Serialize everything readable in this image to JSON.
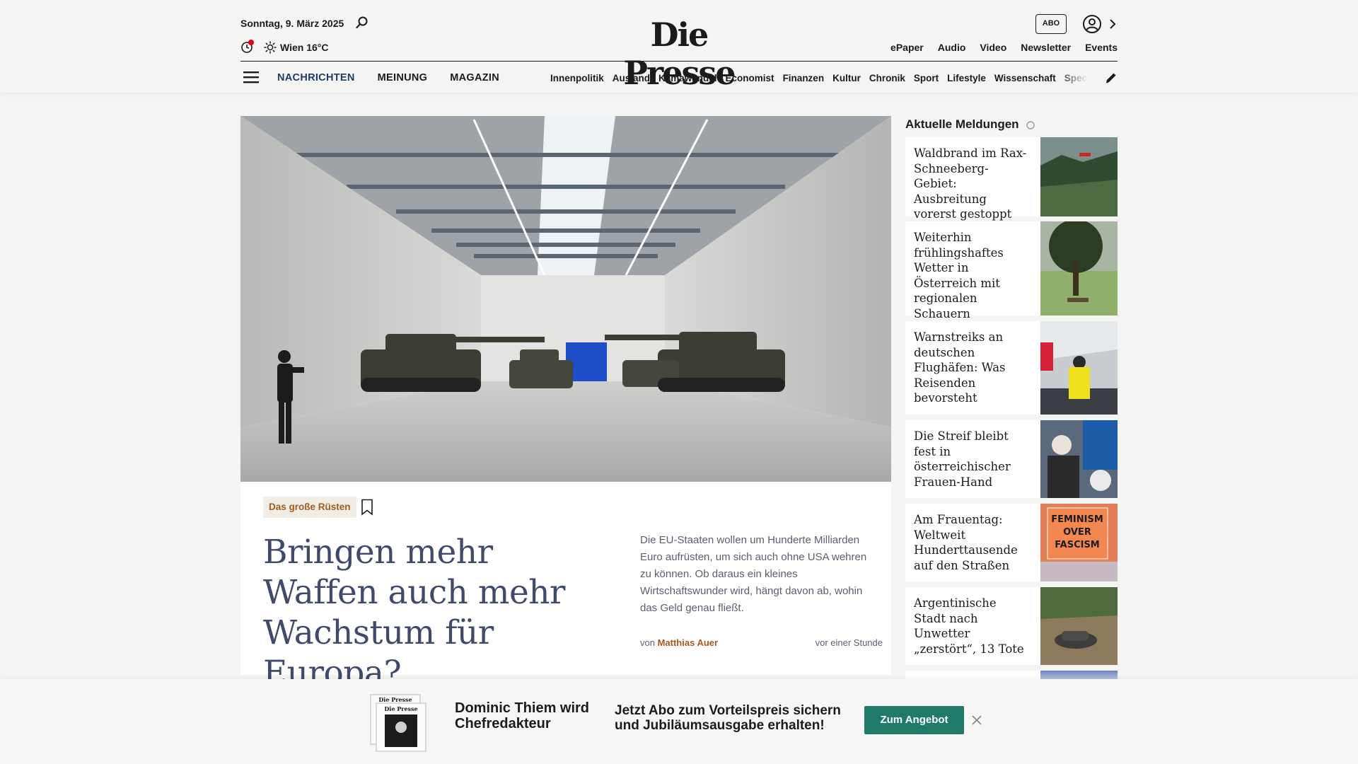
{
  "header": {
    "date": "Sonntag, 9. März 2025",
    "weather": "Wien 16°C",
    "logo": "Die Presse",
    "abo": "ABO",
    "top_links": [
      "ePaper",
      "Audio",
      "Video",
      "Newsletter",
      "Events"
    ],
    "main_nav": [
      "NACHRICHTEN",
      "MEINUNG",
      "MAGAZIN"
    ],
    "sub_nav": [
      "Innenpolitik",
      "Ausland",
      "Klimawandel",
      "Economist",
      "Finanzen",
      "Kultur",
      "Chronik",
      "Sport",
      "Lifestyle",
      "Wissenschaft",
      "Spectrum"
    ]
  },
  "hero": {
    "kicker": "Das große Rüsten",
    "headline": "Bringen mehr Waffen auch mehr Wachstum für Europa?",
    "teaser": "Die EU-Staaten wollen um Hunderte Milliarden Euro aufrüsten, um sich auch ohne USA wehren zu können. Ob daraus ein kleines Wirtschaftswunder wird, hängt davon ab, wohin das Geld genau fließt.",
    "byline_prefix": "von",
    "author": "Matthias Auer",
    "time": "vor einer Stunde"
  },
  "sidebar": {
    "title": "Aktuelle Meldungen",
    "items": [
      {
        "title": "Waldbrand im Rax-Schneeberg-Gebiet: Ausbreitung vorerst gestoppt"
      },
      {
        "title": "Weiterhin frühlingshaftes Wetter in Österreich mit regionalen Schauern"
      },
      {
        "title": "Warnstreiks an deutschen Flughäfen: Was Reisenden bevorsteht"
      },
      {
        "title": "Die Streif bleibt fest in österreichischer Frauen-Hand"
      },
      {
        "title": "Am Frauentag: Weltweit Hunderttausende auf den Straßen",
        "thumb_text": "FEMINISM OVER FASCISM"
      },
      {
        "title": "Argentinische Stadt nach Unwetter „zerstört“, 13 Tote"
      }
    ]
  },
  "promo": {
    "papers_logo": "Die Presse",
    "name": "Dominic Thiem wird Chefredakteur",
    "offer": "Jetzt Abo zum Vorteilspreis sichern und Jubiläumsausgabe erhalten!",
    "button": "Zum Angebot"
  },
  "colors": {
    "accent": "#a55a1d",
    "nav_active": "#1d3d68",
    "button": "#1f7a68",
    "headline": "#414a6b"
  }
}
